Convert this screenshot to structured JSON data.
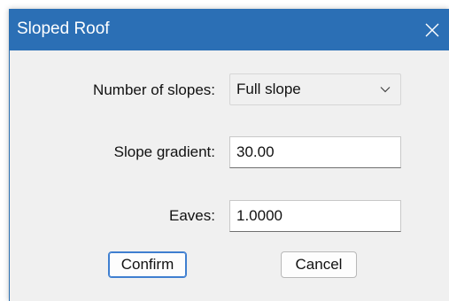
{
  "dialog": {
    "title": "Sloped Roof",
    "close_icon": "close-icon"
  },
  "fields": {
    "slopes": {
      "label": "Number of slopes:",
      "value": "Full slope",
      "icon": "chevron-down-icon"
    },
    "gradient": {
      "label": "Slope gradient:",
      "value": "30.00"
    },
    "eaves": {
      "label": "Eaves:",
      "value": "1.0000"
    }
  },
  "buttons": {
    "confirm": "Confirm",
    "cancel": "Cancel"
  },
  "colors": {
    "titlebar": "#2b6fb5",
    "background": "#f0f0f0",
    "accent": "#3f7fd0"
  }
}
